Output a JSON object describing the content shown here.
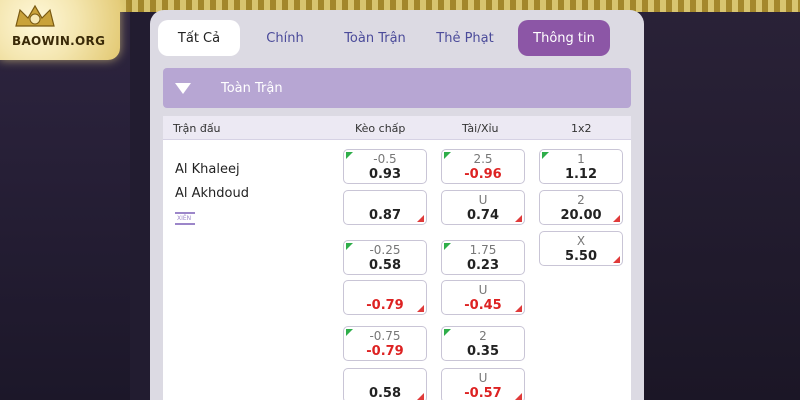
{
  "logo": {
    "text": "BAOWIN.ORG"
  },
  "tabs": [
    {
      "label": "Tất Cả"
    },
    {
      "label": "Chính"
    },
    {
      "label": "Toàn Trận"
    },
    {
      "label": "Thẻ Phạt"
    },
    {
      "label": "Thông tin"
    }
  ],
  "section": {
    "title": "Toàn Trận"
  },
  "columns": {
    "match": "Trận đấu",
    "handicap": "Kèo chấp",
    "overunder": "Tài/Xỉu",
    "onextwo": "1x2"
  },
  "match": {
    "home": "Al Khaleej",
    "away": "Al Akhdoud",
    "parlay_label": "XIÊN"
  },
  "odds": {
    "h1": {
      "line": "-0.5",
      "odds": "0.93"
    },
    "h2": {
      "line": "",
      "odds": "0.87"
    },
    "h3": {
      "line": "-0.25",
      "odds": "0.58"
    },
    "h4": {
      "line": "",
      "odds": "-0.79"
    },
    "h5": {
      "line": "-0.75",
      "odds": "-0.79"
    },
    "h6": {
      "line": "",
      "odds": "0.58"
    },
    "o1": {
      "line": "2.5",
      "odds": "-0.96"
    },
    "o2": {
      "line": "U",
      "odds": "0.74"
    },
    "o3": {
      "line": "1.75",
      "odds": "0.23"
    },
    "o4": {
      "line": "U",
      "odds": "-0.45"
    },
    "o5": {
      "line": "2",
      "odds": "0.35"
    },
    "o6": {
      "line": "U",
      "odds": "-0.57"
    },
    "x1": {
      "line": "1",
      "odds": "1.12"
    },
    "x2": {
      "line": "2",
      "odds": "20.00"
    },
    "x3": {
      "line": "X",
      "odds": "5.50"
    }
  },
  "colors": {
    "accent_purple": "#8c56a6",
    "header_purple": "#b7a6d3",
    "positive": "#222222",
    "negative": "#dd2222",
    "up_arrow": "#2fae4a",
    "down_arrow": "#e03a3a"
  }
}
